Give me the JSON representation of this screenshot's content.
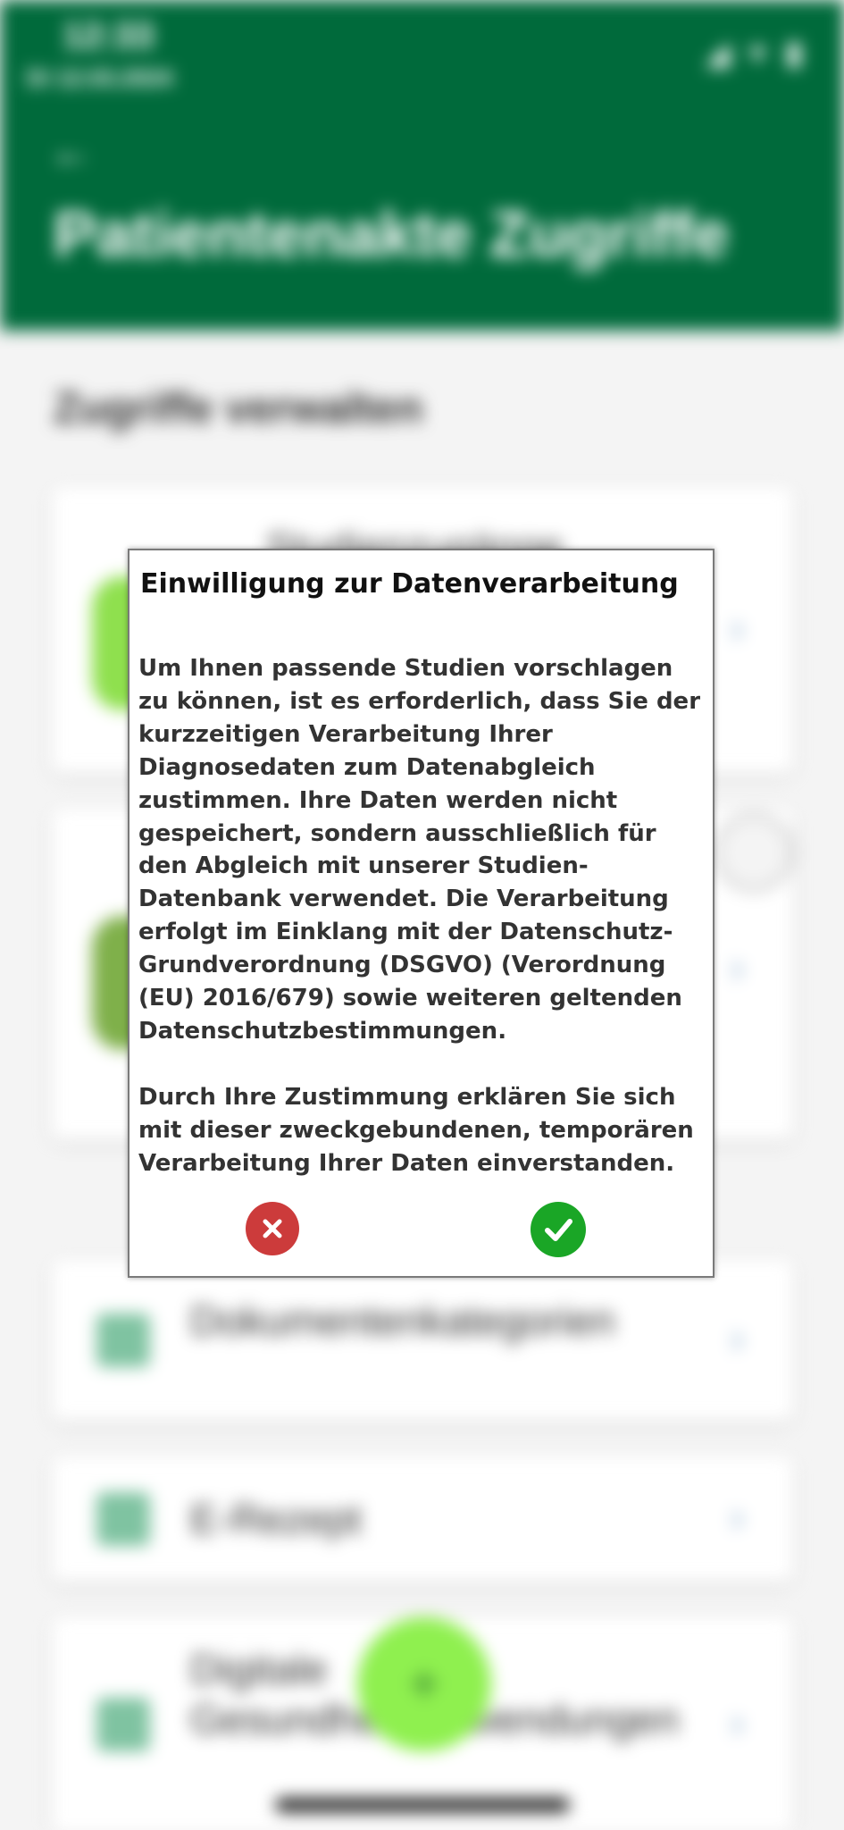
{
  "background": {
    "status_bar": {
      "time": "12:33",
      "date": "Di 12.03.2024",
      "icons": "◢ ▾ ▮"
    },
    "header": {
      "back_icon": "←",
      "title": "Patientenakte Zugriffe"
    },
    "section_heading": "Zugriffe verwalten",
    "cards": [
      {
        "label": "Studienzugänge",
        "icon": "studies-icon"
      },
      {
        "label": "",
        "icon": "person-icon"
      },
      {
        "label": "Dokumentenkategorien",
        "icon": "document-icon"
      },
      {
        "label": "E-Rezept",
        "icon": "prescription-icon"
      },
      {
        "label": "Digitale Gesundheitsanwendungen",
        "icon": "app-icon"
      }
    ],
    "chevron": "›",
    "fab_label": "+"
  },
  "dialog": {
    "title": "Einwilligung zur Datenverarbeitung",
    "paragraph_1": "Um Ihnen passende Studien vorschlagen zu können, ist es erforderlich, dass Sie der kurzzeitigen Verarbeitung Ihrer Diagnosedaten zum Datenabgleich zustimmen. Ihre Daten werden nicht gespeichert, sondern ausschließlich für den Abgleich mit unserer Studien-Datenbank verwendet. Die Verarbeitung erfolgt im Einklang mit der Datenschutz-Grundverordnung (DSGVO) (Verordnung (EU) 2016/679) sowie weiteren geltenden Datenschutzbestimmungen.",
    "paragraph_2": "Durch Ihre Zustimmung erklären Sie sich mit dieser zweckgebundenen, temporären Verarbeitung Ihrer Daten einverstanden.",
    "decline_icon": "close-icon",
    "accept_icon": "checkmark-icon"
  },
  "colors": {
    "header_green": "#006a3b",
    "decline_red": "#cc3b3b",
    "accept_green": "#1aa626",
    "accent_light_green": "#8ff04f"
  }
}
